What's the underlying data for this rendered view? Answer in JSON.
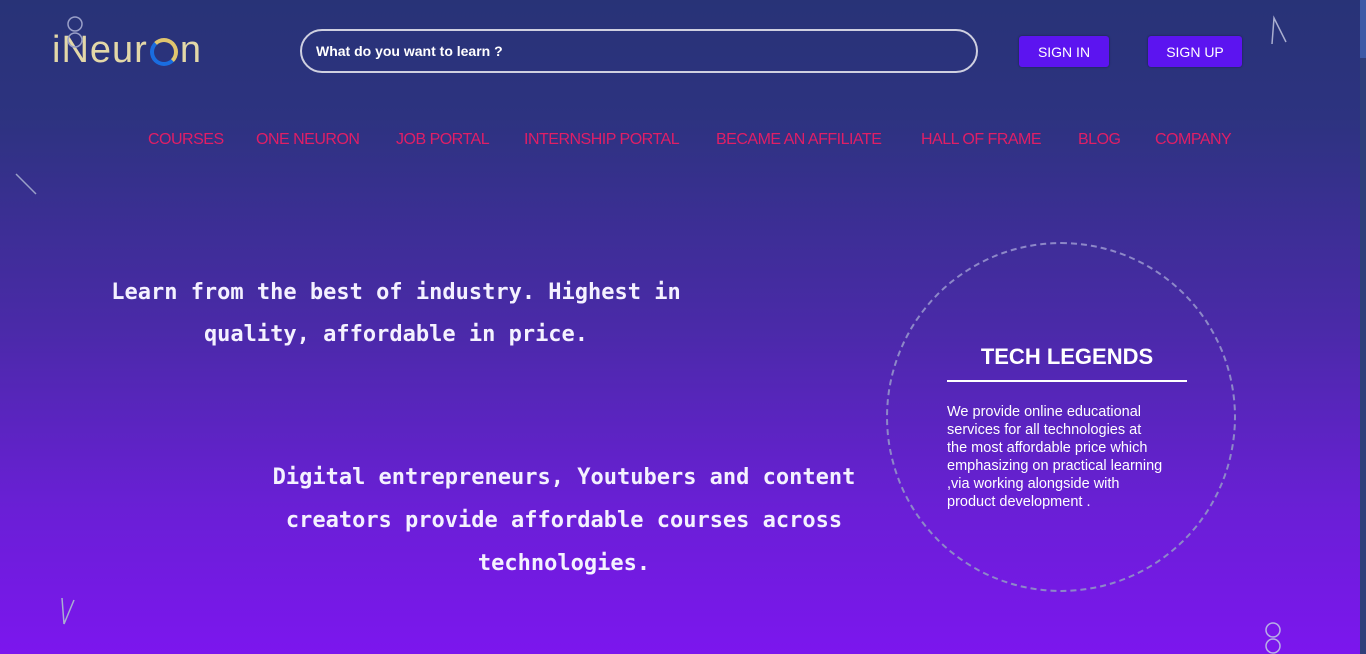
{
  "header": {
    "logo_text_left": "iNeur",
    "logo_text_right": "n",
    "search_placeholder": "What do you want to learn ?",
    "sign_in_label": "SIGN IN",
    "sign_up_label": "SIGN UP"
  },
  "nav": {
    "items": [
      {
        "label": "COURSES"
      },
      {
        "label": "ONE NEURON"
      },
      {
        "label": "JOB PORTAL"
      },
      {
        "label": "INTERNSHIP PORTAL"
      },
      {
        "label": "BECAME AN AFFILIATE"
      },
      {
        "label": "HALL OF FRAME"
      },
      {
        "label": "BLOG"
      },
      {
        "label": "COMPANY"
      }
    ]
  },
  "hero": {
    "line1": "Learn from the best of industry. Highest in",
    "line2": "quality, affordable in price.",
    "line3": "Digital entrepreneurs, Youtubers and content",
    "line4": "creators provide affordable courses across",
    "line5": "technologies."
  },
  "tech_legends": {
    "title": "TECH LEGENDS",
    "lines": [
      "We provide online educational",
      "services for all technologies at",
      "the most affordable price which",
      "emphasizing on practical learning",
      ",via working alongside with",
      "product development ."
    ]
  },
  "colors": {
    "nav_link": "#e01e66",
    "button_bg": "#5c14f0",
    "logo_text": "#e3d8a8"
  }
}
